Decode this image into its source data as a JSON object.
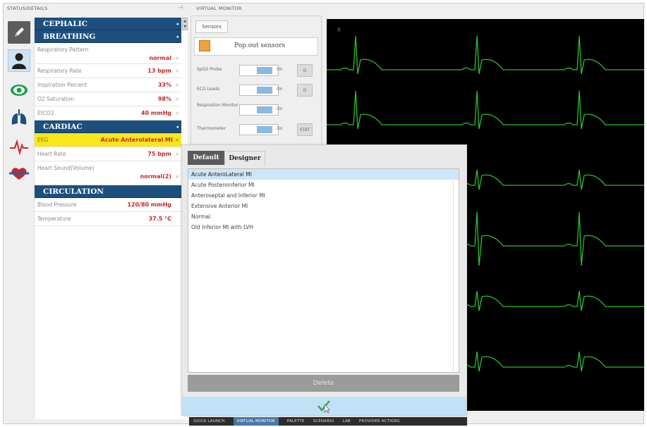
{
  "status_panel": {
    "header": "STATUS/DETAILS",
    "pin_glyph": "⊣",
    "categories": {
      "cephalic": {
        "title": "CEPHALIC"
      },
      "breathing": {
        "title": "BREATHING",
        "rows": [
          {
            "label": "Respiratory Pattern",
            "value": "normal"
          },
          {
            "label": "Respiratory Rate",
            "value": "13 bpm"
          },
          {
            "label": "Inspiration Percent",
            "value": "33%"
          },
          {
            "label": "O2 Saturation",
            "value": "98%"
          },
          {
            "label": "EtCO2",
            "value": "40 mmHg"
          }
        ]
      },
      "cardiac": {
        "title": "CARDIAC",
        "rows": [
          {
            "label": "EKG",
            "value": "Acute Anterolateral MI"
          },
          {
            "label": "Heart Rate",
            "value": "75 bpm"
          },
          {
            "label": "Heart Sound(Volume)",
            "value": "normal(2)"
          }
        ]
      },
      "circulation": {
        "title": "CIRCULATION",
        "rows": [
          {
            "label": "Blood Pressure",
            "value": "120/80 mmHg"
          },
          {
            "label": "Temperature",
            "value": "37.5 °C"
          }
        ]
      }
    },
    "dropdown_glyph": "◂",
    "remove_glyph": "×",
    "icons": [
      "pen-icon",
      "person-icon",
      "eye-icon",
      "lungs-icon",
      "pulse-icon",
      "heart-icon"
    ]
  },
  "virtual_monitor": {
    "header": "VIRTUAL MONITOR",
    "sensors_tab": "Sensors",
    "pop_out_label": "Pop out sensors",
    "lead_label": "II",
    "sensors": [
      {
        "name": "SpO2 Probe",
        "state": "On",
        "button": "O"
      },
      {
        "name": "ECG Leads",
        "state": "On",
        "button": "O"
      },
      {
        "name": "Respiration Monitor",
        "state": "On",
        "button": ""
      },
      {
        "name": "Thermometer",
        "state": "On",
        "button": "STAT"
      }
    ]
  },
  "ecg_popup": {
    "tabs": [
      "Default",
      "Designer"
    ],
    "active_tab": "Default",
    "items": [
      "Acute AnteroLateral MI",
      "Acute Posteroinferior MI",
      "Anteroseptal and Inferior MI",
      "Extensive Anterior MI",
      "Normal",
      "Old Inferior MI with LVH"
    ],
    "selected_index": 0,
    "delete_label": "Delete"
  },
  "bottom_nav": {
    "items": [
      "QUICK LAUNCH",
      "VIRTUAL MONITOR",
      "PALETTE",
      "SCENARIO",
      "LAB",
      "PROVIDER ACTIONS"
    ],
    "active_index": 1
  },
  "colors": {
    "category_header": "#1c4f7d",
    "value_red": "#c62828",
    "ekg_highlight": "#f8e71c",
    "ecg_trace": "#27c427",
    "list_selection": "#cfe6f9",
    "ok_bar": "#bfe2f7"
  }
}
